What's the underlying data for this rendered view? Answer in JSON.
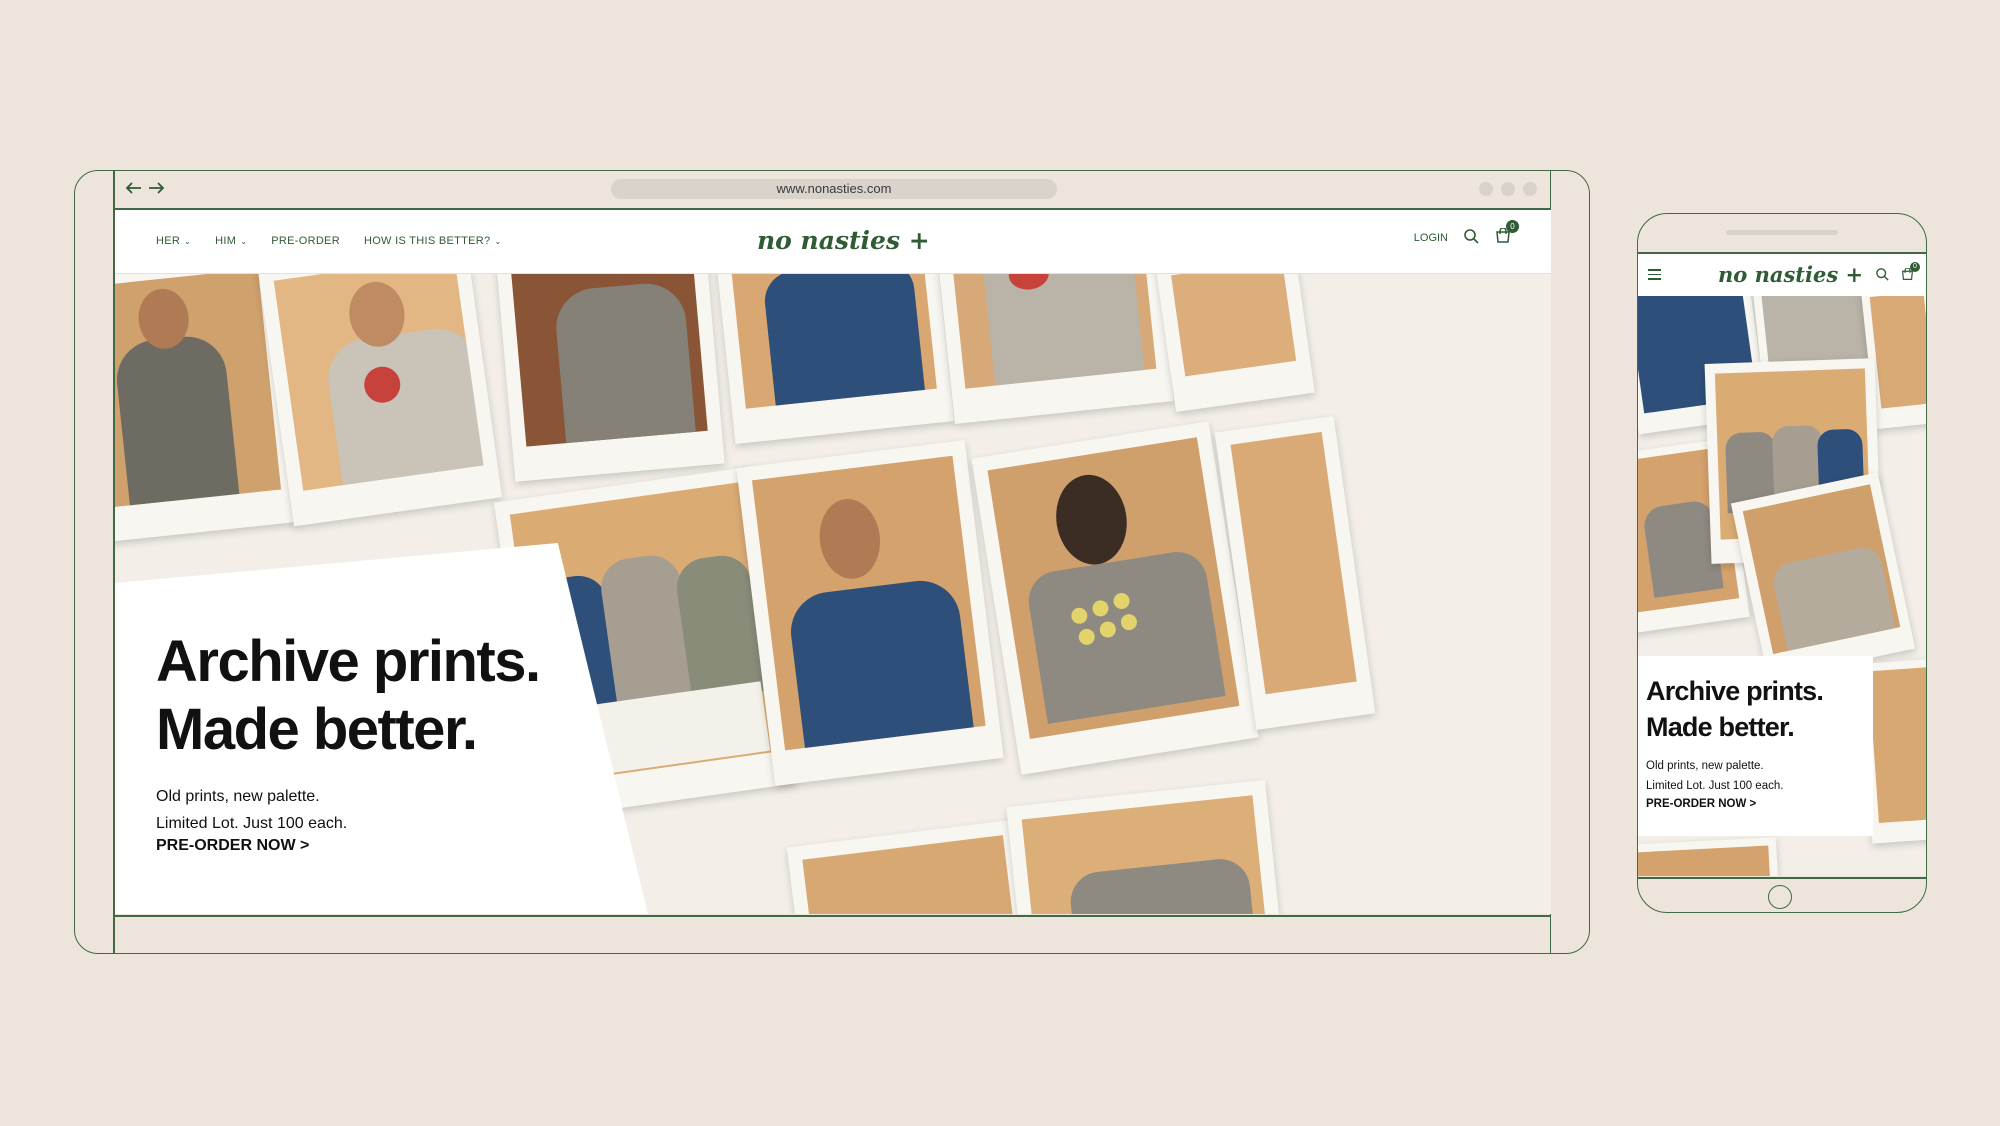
{
  "browser": {
    "url": "www.nonasties.com"
  },
  "site": {
    "logo": "no nasties +",
    "nav": [
      {
        "label": "HER",
        "dropdown": true
      },
      {
        "label": "HIM",
        "dropdown": true
      },
      {
        "label": "PRE-ORDER",
        "dropdown": false
      },
      {
        "label": "HOW IS THIS BETTER?",
        "dropdown": true
      }
    ],
    "login": "LOGIN",
    "cart_count": "0",
    "hero": {
      "headline_1": "Archive prints.",
      "headline_2": "Made better.",
      "sub_1": "Old prints, new palette.",
      "sub_2": "Limited Lot. Just 100 each.",
      "cta": "PRE-ORDER NOW >"
    }
  },
  "colors": {
    "brand_green": "#2f5b35",
    "background": "#ede5dc",
    "tee_blue": "#2e4f7a",
    "tee_grey": "#8e8a82"
  },
  "icons": [
    "back-arrow-icon",
    "forward-arrow-icon",
    "search-icon",
    "cart-icon",
    "hamburger-icon"
  ]
}
